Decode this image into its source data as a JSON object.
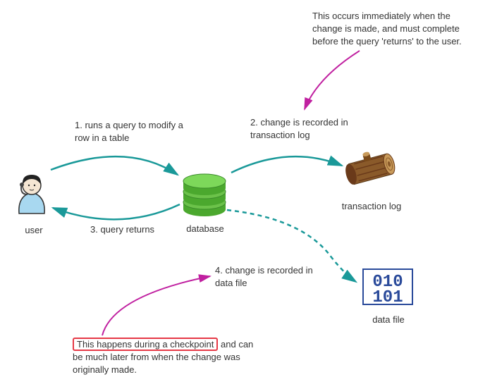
{
  "annotations": {
    "top_note": "This occurs immediately when the change is made, and must complete before the query 'returns' to the user.",
    "bottom_note_highlight": "This happens during a checkpoint",
    "bottom_note_rest": " and can be much later from when the change was originally made."
  },
  "steps": {
    "step1": "1. runs a query to modify a row in a table",
    "step2": "2. change is recorded in transaction log",
    "step3": "3. query returns",
    "step4": "4. change is recorded in data file"
  },
  "nodes": {
    "user": "user",
    "database": "database",
    "txlog": "transaction log",
    "datafile": "data file"
  },
  "colors": {
    "teal": "#1a9999",
    "magenta": "#c020a0",
    "green_light": "#6cc24a",
    "green_dark": "#3a8a2a",
    "brown": "#7a4a1a",
    "blue_light": "#a8d8f0",
    "red_box": "#e63946"
  }
}
